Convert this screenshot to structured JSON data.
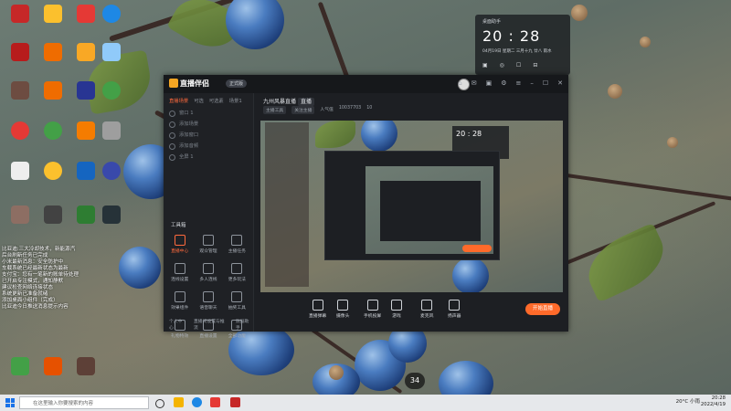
{
  "desktop": {
    "icon_labels": [
      "",
      "",
      "",
      "",
      "",
      "",
      "",
      "",
      "",
      "",
      "",
      "",
      "",
      "",
      "",
      "",
      "",
      "",
      "",
      "",
      "",
      "",
      "",
      ""
    ],
    "notifications": [
      "比亚迪:三大冷却技术，新能源汽",
      "后台刷新任务已完成",
      "小米最新消息：安全防护中",
      "车载系统已经最新状态为最新",
      "支付宝：您有一笔新的账单待处理",
      "已开启专注模式，通知静默",
      "建议检查网络连接状态",
      "系统更新已准备就绪",
      "添加桌面小组件（完成）",
      "比亚迪今日推送消息提示内容"
    ],
    "clock": {
      "title": "桌面助手",
      "time": "20 : 28",
      "date": "04月19日  星期二  三月十九  廿八 雨水",
      "actions": [
        "▣",
        "◎",
        "☐",
        "⊟"
      ]
    },
    "badge": "34"
  },
  "app": {
    "title": "直播伴侣",
    "version": "正式版",
    "left_tabs": [
      "直播场景",
      "可选",
      "可选素",
      "场景1"
    ],
    "scenes": [
      "窗口 1",
      "添加场景",
      "添加窗口",
      "添加音频",
      "全屏 1"
    ],
    "tools_heading": "工具箱",
    "tools": [
      {
        "label": "直播中心",
        "hot": true
      },
      {
        "label": "观众管理",
        "hot": false
      },
      {
        "label": "主播任务",
        "hot": false
      },
      {
        "label": "连线设置",
        "hot": false
      },
      {
        "label": "多人连线",
        "hot": false
      },
      {
        "label": "更多玩法",
        "hot": false
      },
      {
        "label": "效果组件",
        "hot": false
      },
      {
        "label": "语音聊天",
        "hot": false
      },
      {
        "label": "抽奖工具",
        "hot": false
      },
      {
        "label": "礼物特效",
        "hot": false
      },
      {
        "label": "直播设置",
        "hot": false
      },
      {
        "label": "全部功能",
        "hot": false
      }
    ],
    "footer_tabs": [
      "个人中心",
      "直播间设置与推流",
      "数据助手"
    ],
    "room_name": "九州风暴直播",
    "room_tag": "直播",
    "room_info": [
      "主播工具",
      "关注主播",
      "人气值",
      "10037703",
      "10"
    ],
    "bottom_buttons": [
      "直播弹幕",
      "摄像头",
      "手机投屏",
      "游戏",
      "麦克风",
      "扬声器"
    ],
    "start_label": "开始直播"
  },
  "taskbar": {
    "search_placeholder": "在这里输入你要搜索的内容",
    "weather": "20°C 小雨",
    "time": "20:28",
    "date": "2022/4/19"
  }
}
